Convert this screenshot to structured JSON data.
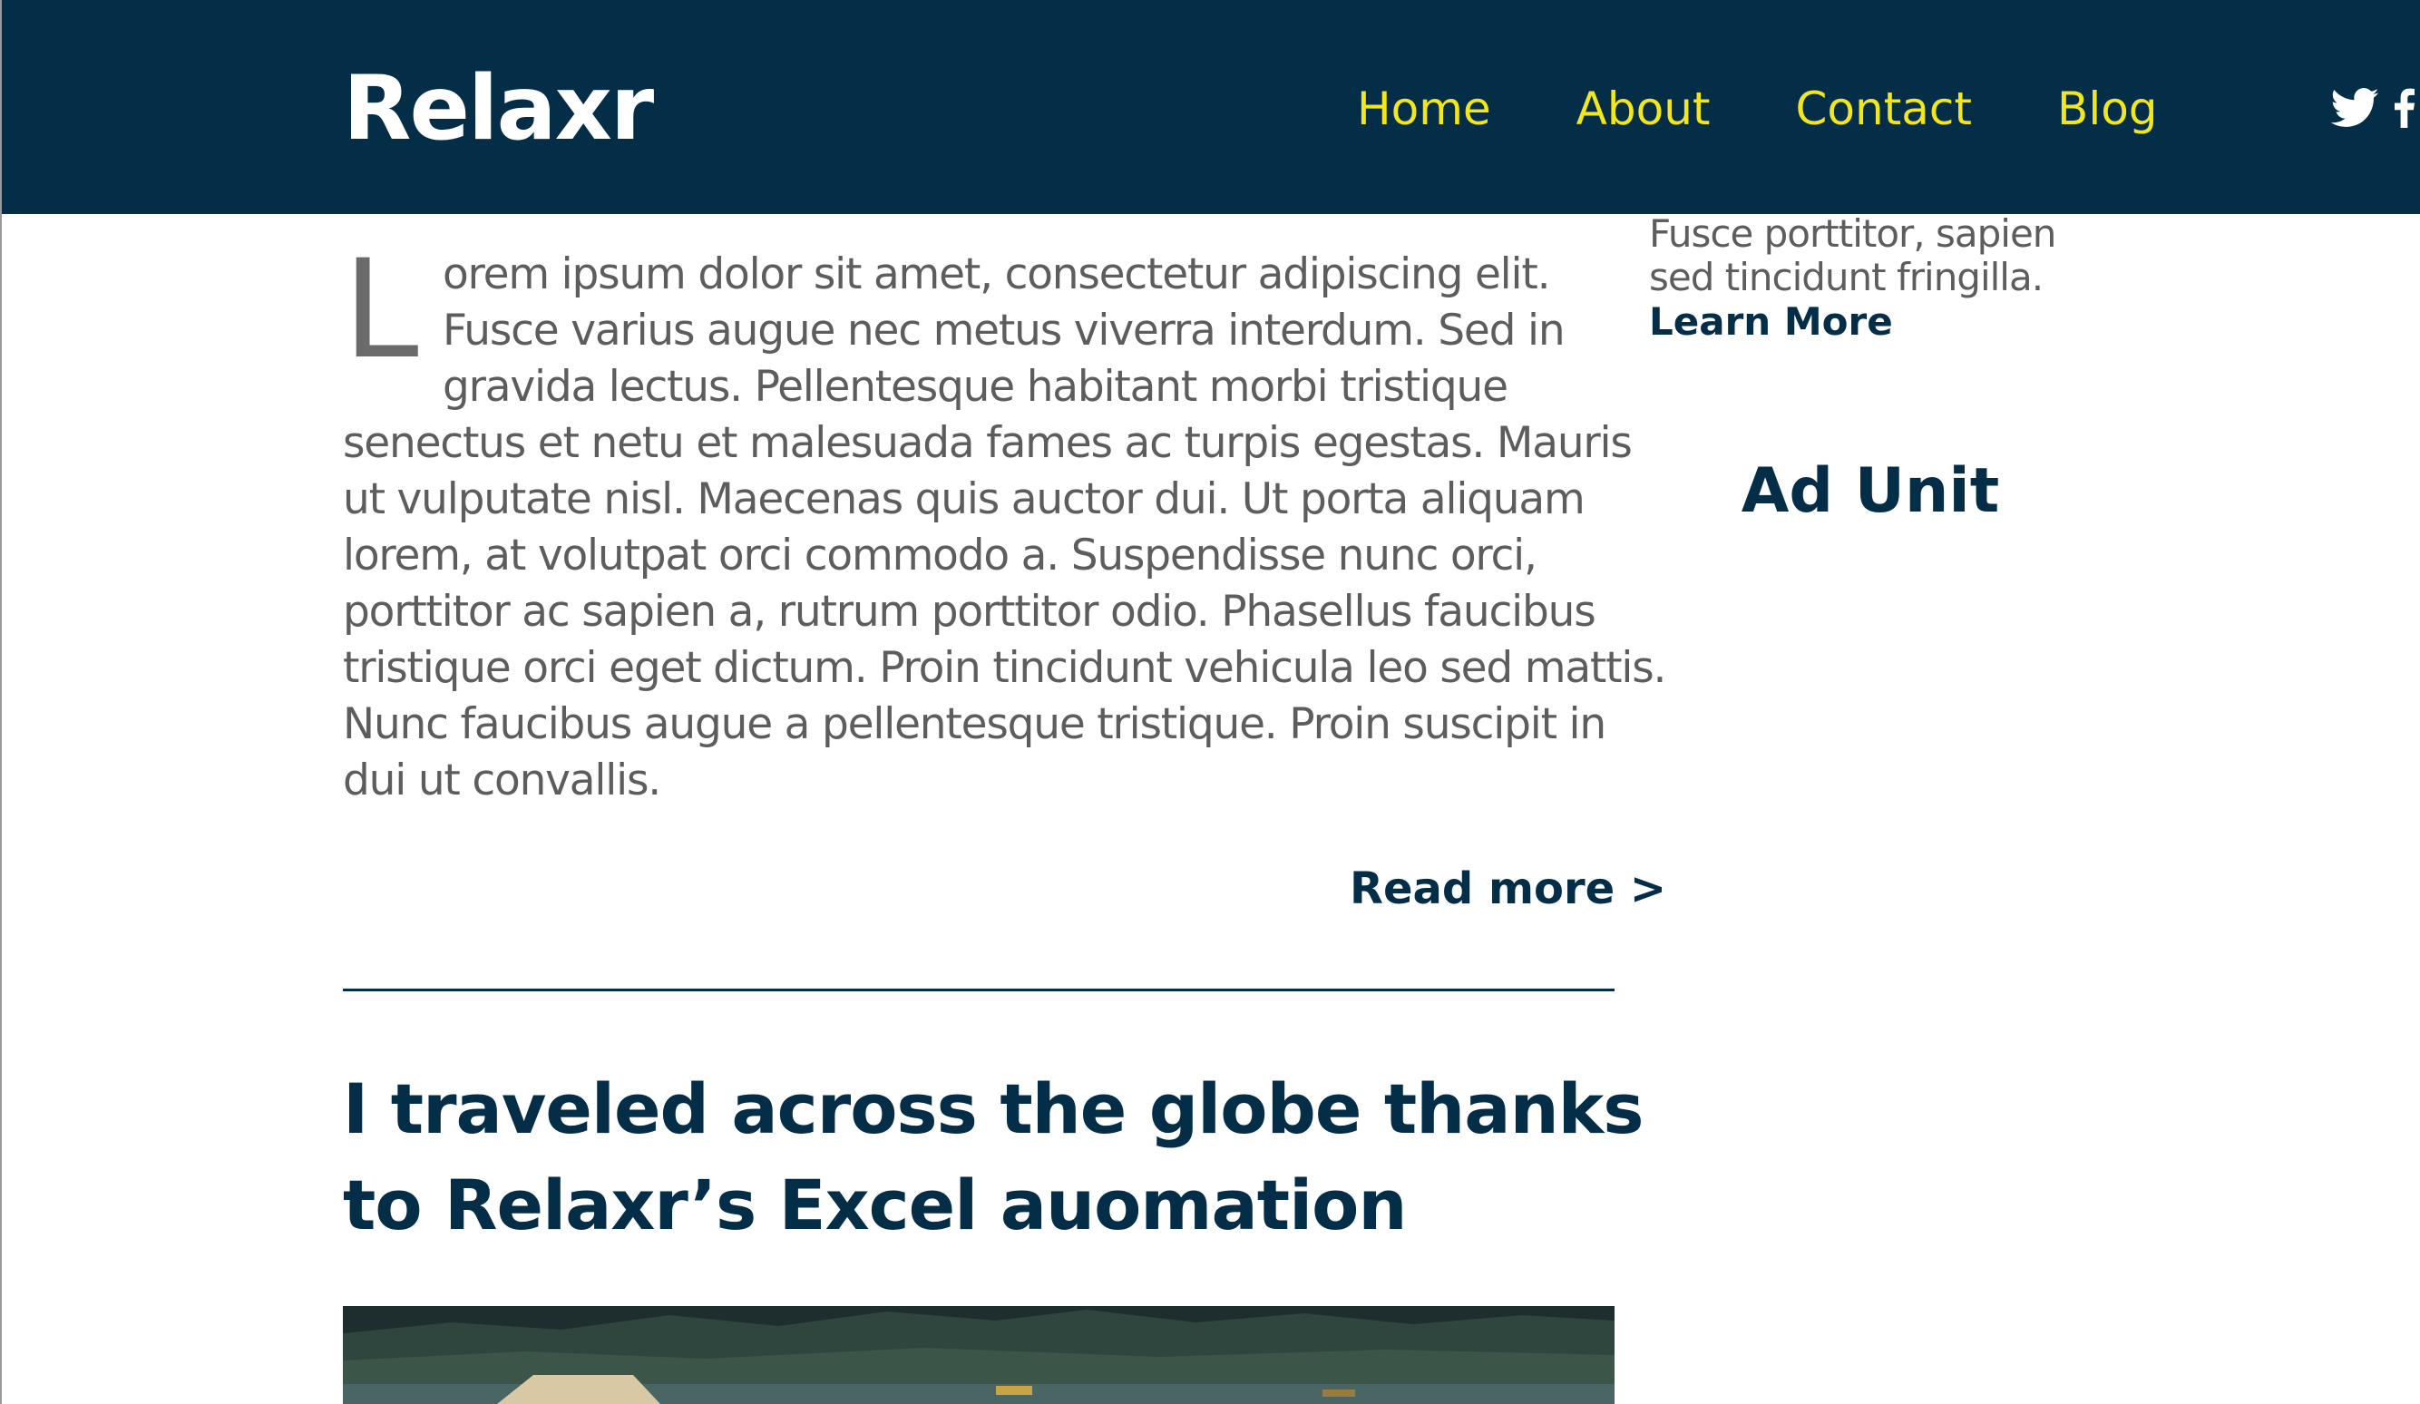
{
  "header": {
    "logo": "Relaxr",
    "nav": [
      "Home",
      "About",
      "Contact",
      "Blog"
    ],
    "social": [
      "twitter-icon",
      "facebook-icon"
    ],
    "colors": {
      "background": "#042d47",
      "nav_link": "#f2e61c",
      "logo": "#ffffff"
    }
  },
  "article": {
    "dropcap": "L",
    "lines": [
      "orem ipsum dolor sit amet, consectetur adipiscing elit.",
      "Fusce varius augue nec metus viverra interdum. Sed in",
      "gravida lectus. Pellentesque habitant morbi tristique",
      "senectus et netu et malesuada fames ac turpis egestas. Mauris",
      "ut vulputate nisl. Maecenas quis auctor dui. Ut porta aliquam",
      "lorem, at volutpat orci commodo a. Suspendisse nunc orci,",
      "porttitor ac sapien a, rutrum porttitor odio. Phasellus faucibus",
      "tristique orci eget dictum. Proin tincidunt vehicula leo sed mattis.",
      "Nunc faucibus augue a pellentesque tristique. Proin suscipit in",
      "dui ut convallis."
    ],
    "read_more": "Read more >"
  },
  "next_post": {
    "title_lines": [
      "I traveled across the globe thanks",
      "to Relaxr’s Excel auomation"
    ]
  },
  "sidebar": {
    "text_lines": [
      "Fusce porttitor, sapien",
      "sed tincidunt fringilla."
    ],
    "learn_more": "Learn More",
    "ad_unit": "Ad Unit"
  }
}
